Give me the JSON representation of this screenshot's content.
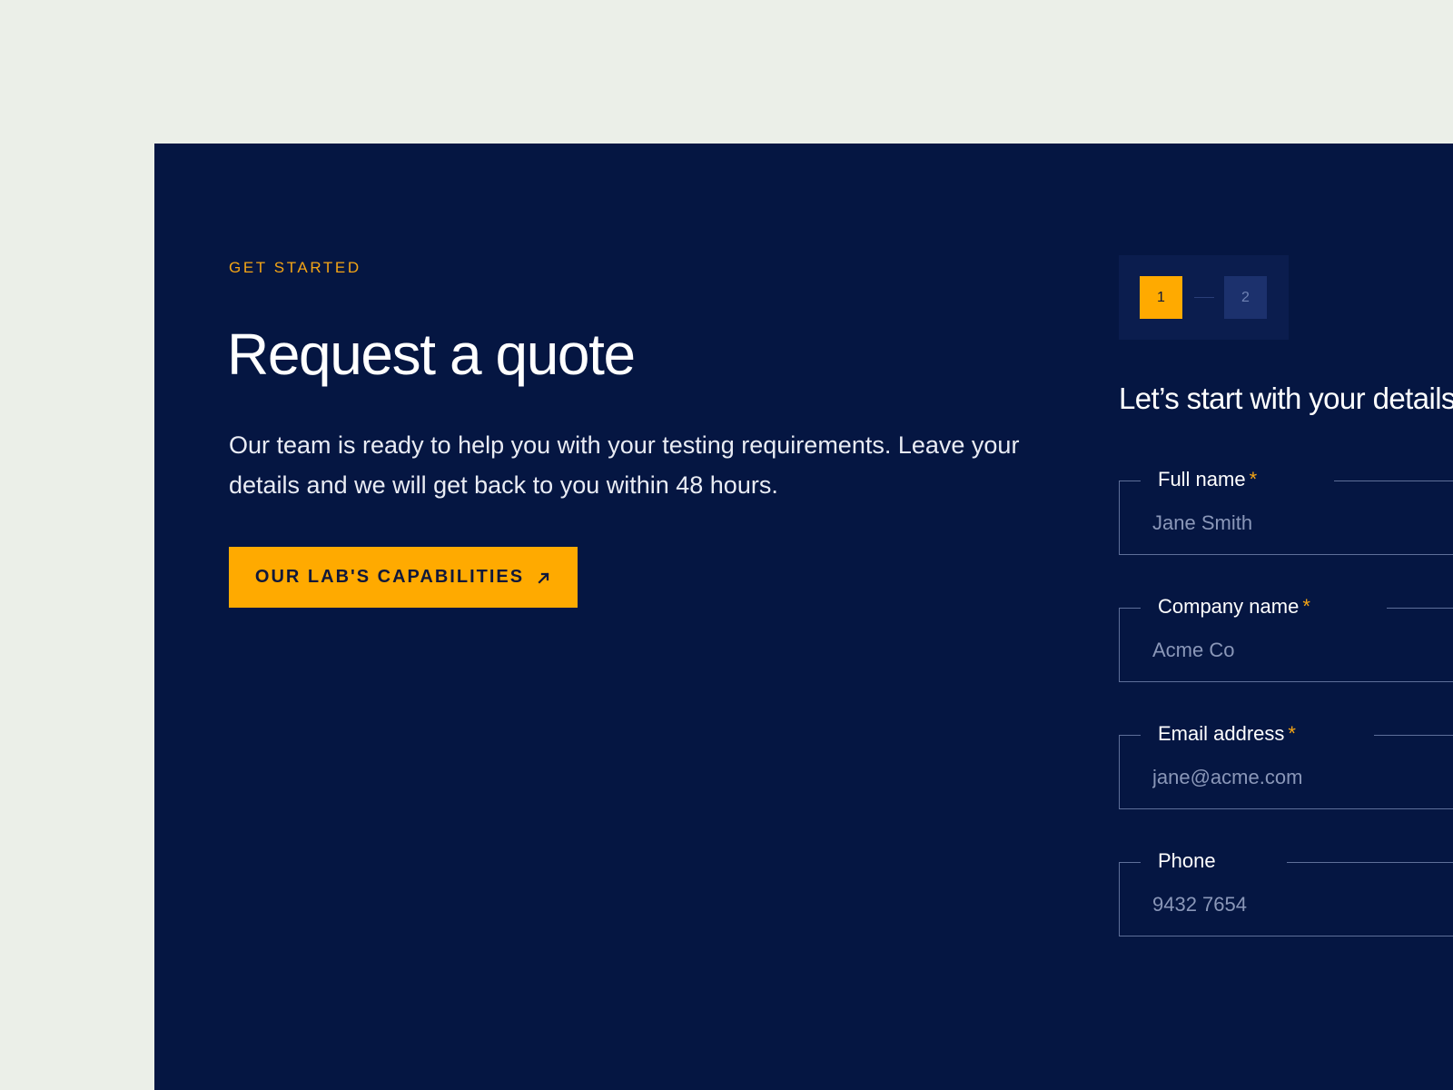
{
  "hero": {
    "eyebrow": "GET STARTED",
    "title": "Request a quote",
    "lead": "Our team is ready to help you with your testing requirements. Leave your details and we will get back to you within 48 hours.",
    "cta_label": "OUR LAB'S CAPABILITIES",
    "cta_icon": "arrow-up-right-icon"
  },
  "stepper": {
    "steps": [
      {
        "label": "1",
        "state": "active"
      },
      {
        "label": "2",
        "state": "inactive"
      }
    ]
  },
  "form": {
    "heading": "Let’s start with your details",
    "fields": [
      {
        "label": "Full name",
        "required": "*",
        "placeholder": "Jane Smith",
        "value": ""
      },
      {
        "label": "Company name",
        "required": "*",
        "placeholder": "Acme Co",
        "value": ""
      },
      {
        "label": "Email address",
        "required": "*",
        "placeholder": "jane@acme.com",
        "value": ""
      },
      {
        "label": "Phone",
        "required": "",
        "placeholder": "9432 7654",
        "value": ""
      }
    ]
  },
  "colors": {
    "background": "#ebefe8",
    "panel": "#051642",
    "accent": "#ffaa00",
    "text": "#ffffff"
  }
}
